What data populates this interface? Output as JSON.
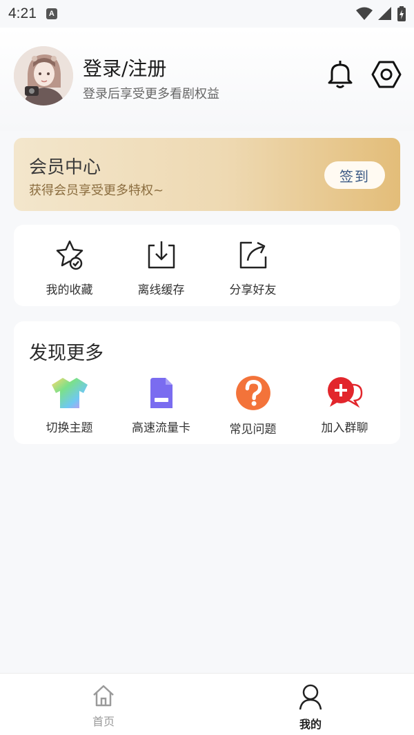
{
  "status_bar": {
    "time": "4:21",
    "badge": "A"
  },
  "header": {
    "title": "登录/注册",
    "subtitle": "登录后享受更多看剧权益"
  },
  "vip": {
    "title": "会员中心",
    "subtitle": "获得会员享受更多特权~",
    "checkin_label": "签到",
    "colors": {
      "gradient_start": "#f3e6cc",
      "gradient_end": "#e3bd79"
    }
  },
  "tools": [
    {
      "label": "我的收藏",
      "icon": "star-check-icon"
    },
    {
      "label": "离线缓存",
      "icon": "download-icon"
    },
    {
      "label": "分享好友",
      "icon": "share-icon"
    }
  ],
  "discover": {
    "title": "发现更多",
    "items": [
      {
        "label": "切换主题",
        "icon": "theme-shirt-icon"
      },
      {
        "label": "高速流量卡",
        "icon": "sim-card-icon"
      },
      {
        "label": "常见问题",
        "icon": "question-icon"
      },
      {
        "label": "加入群聊",
        "icon": "group-chat-add-icon"
      }
    ]
  },
  "tabbar": [
    {
      "label": "首页",
      "icon": "home-icon",
      "active": false
    },
    {
      "label": "我的",
      "icon": "user-icon",
      "active": true
    }
  ]
}
